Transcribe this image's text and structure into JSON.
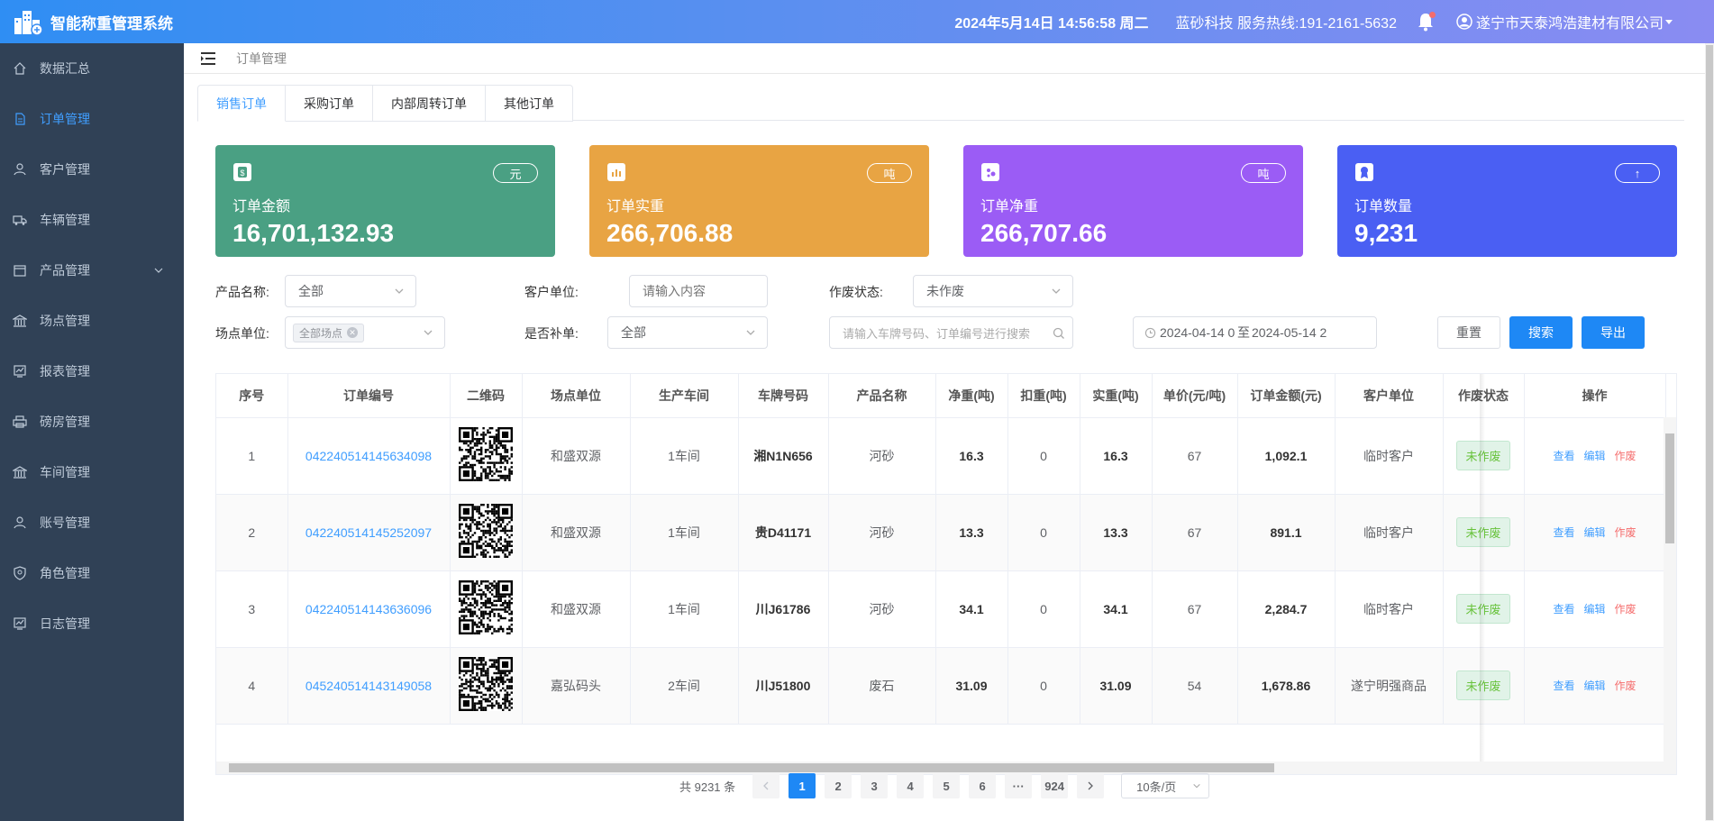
{
  "app": {
    "title": "智能称重管理系统",
    "datetime": "2024年5月14日 14:56:58 周二",
    "service": "蓝砂科技 服务热线:191-2161-5632",
    "company": "遂宁市天泰鸿浩建材有限公司"
  },
  "sidebar": {
    "items": [
      {
        "label": "数据汇总",
        "icon": "home-icon"
      },
      {
        "label": "订单管理",
        "icon": "document-icon"
      },
      {
        "label": "客户管理",
        "icon": "user-icon"
      },
      {
        "label": "车辆管理",
        "icon": "truck-icon"
      },
      {
        "label": "产品管理",
        "icon": "box-icon"
      },
      {
        "label": "场点管理",
        "icon": "bank-icon"
      },
      {
        "label": "报表管理",
        "icon": "chart-icon"
      },
      {
        "label": "磅房管理",
        "icon": "printer-icon"
      },
      {
        "label": "车间管理",
        "icon": "bank-icon"
      },
      {
        "label": "账号管理",
        "icon": "user-icon"
      },
      {
        "label": "角色管理",
        "icon": "shield-icon"
      },
      {
        "label": "日志管理",
        "icon": "chart-icon"
      }
    ],
    "active_index": 1
  },
  "breadcrumb": "订单管理",
  "tabs": [
    "销售订单",
    "采购订单",
    "内部周转订单",
    "其他订单"
  ],
  "cards": [
    {
      "label": "订单金额",
      "value": "16,701,132.93",
      "unit": "元",
      "color": "#4aa083"
    },
    {
      "label": "订单实重",
      "value": "266,706.88",
      "unit": "吨",
      "color": "#e8a443"
    },
    {
      "label": "订单净重",
      "value": "266,707.66",
      "unit": "吨",
      "color": "#9b5cf5"
    },
    {
      "label": "订单数量",
      "value": "9,231",
      "unit": "↑",
      "color": "#4a5ff3"
    }
  ],
  "filters": {
    "product_label": "产品名称:",
    "product_value": "全部",
    "customer_label": "客户单位:",
    "customer_placeholder": "请输入内容",
    "void_label": "作废状态:",
    "void_value": "未作废",
    "site_label": "场点单位:",
    "site_tag": "全部场点",
    "supp_label": "是否补单:",
    "supp_value": "全部",
    "search_placeholder": "请输入车牌号码、订单编号进行搜索",
    "date_start": "2024-04-14 0",
    "date_sep": "至",
    "date_end": "2024-05-14 2",
    "reset": "重置",
    "search": "搜索",
    "export": "导出"
  },
  "table": {
    "headers": [
      "序号",
      "订单编号",
      "二维码",
      "场点单位",
      "生产车间",
      "车牌号码",
      "产品名称",
      "净重(吨)",
      "扣重(吨)",
      "实重(吨)",
      "单价(元/吨)",
      "订单金额(元)",
      "客户单位",
      "作废状态",
      "操作"
    ],
    "rows": [
      {
        "idx": "1",
        "order": "042240514145634098",
        "site": "和盛双源",
        "workshop": "1车间",
        "plate": "湘N1N656",
        "product": "河砂",
        "net": "16.3",
        "deduct": "0",
        "actual": "16.3",
        "price": "67",
        "amount": "1,092.1",
        "customer": "临时客户",
        "status": "未作废"
      },
      {
        "idx": "2",
        "order": "042240514145252097",
        "site": "和盛双源",
        "workshop": "1车间",
        "plate": "贵D41171",
        "product": "河砂",
        "net": "13.3",
        "deduct": "0",
        "actual": "13.3",
        "price": "67",
        "amount": "891.1",
        "customer": "临时客户",
        "status": "未作废"
      },
      {
        "idx": "3",
        "order": "042240514143636096",
        "site": "和盛双源",
        "workshop": "1车间",
        "plate": "川J61786",
        "product": "河砂",
        "net": "34.1",
        "deduct": "0",
        "actual": "34.1",
        "price": "67",
        "amount": "2,284.7",
        "customer": "临时客户",
        "status": "未作废"
      },
      {
        "idx": "4",
        "order": "045240514143149058",
        "site": "嘉弘码头",
        "workshop": "2车间",
        "plate": "川J51800",
        "product": "废石",
        "net": "31.09",
        "deduct": "0",
        "actual": "31.09",
        "price": "54",
        "amount": "1,678.86",
        "customer": "遂宁明强商品",
        "status": "未作废"
      }
    ],
    "ops": {
      "view": "查看",
      "edit": "编辑",
      "void": "作废"
    }
  },
  "pagination": {
    "total": "共 9231 条",
    "pages": [
      "1",
      "2",
      "3",
      "4",
      "5",
      "6",
      "···",
      "924"
    ],
    "current": "1",
    "page_size": "10条/页"
  }
}
